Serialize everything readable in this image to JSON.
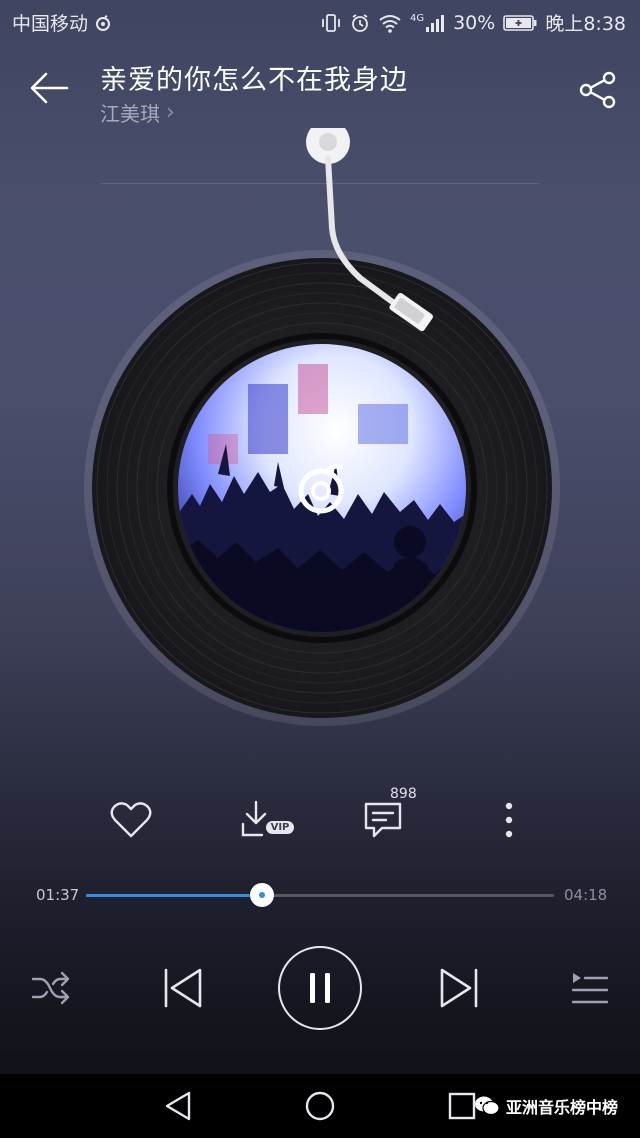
{
  "status_bar": {
    "carrier": "中国移动",
    "network": "4G",
    "battery": "30%",
    "time": "晚上8:38"
  },
  "header": {
    "song_title": "亲爱的你怎么不在我身边",
    "artist": "江美琪",
    "artist_chevron": "›"
  },
  "actions": {
    "vip_badge": "VIP",
    "comment_count": "898"
  },
  "progress": {
    "current_time": "01:37",
    "total_time": "04:18",
    "fraction": 0.376
  },
  "watermark": {
    "text": "亚洲音乐榜中榜"
  },
  "colors": {
    "accent": "#2f8fe6",
    "title": "#ffffff",
    "artist": "#a7a9bc"
  },
  "icons": {
    "back": "arrow-left-icon",
    "share": "share-icon",
    "like": "heart-icon",
    "download": "download-vip-icon",
    "comment": "comment-icon",
    "more": "more-vertical-icon",
    "shuffle": "shuffle-icon",
    "previous": "previous-icon",
    "pause": "pause-icon",
    "next": "next-icon",
    "playlist": "playlist-icon"
  }
}
